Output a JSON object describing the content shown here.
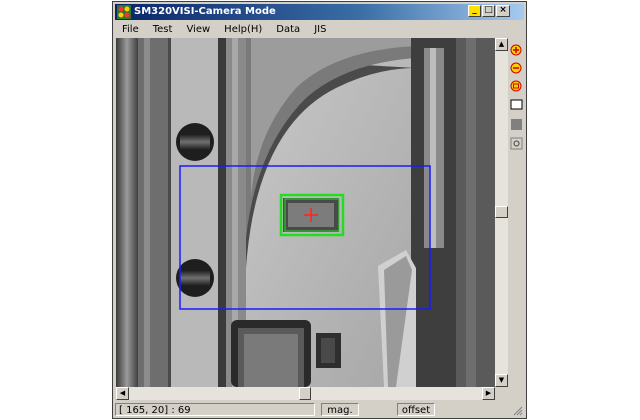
{
  "window": {
    "title": "SM320VISI-Camera Mode",
    "buttons": {
      "minimize": "_",
      "maximize": "□",
      "close": "×"
    }
  },
  "menu": {
    "items": [
      "File",
      "Test",
      "View",
      "Help(H)",
      "Data",
      "JIS"
    ]
  },
  "toolbar": {
    "icons": [
      "zoom-in-icon",
      "zoom-out-icon",
      "zoom-fit-icon",
      "rectangle-icon",
      "fill-icon",
      "settings-icon"
    ]
  },
  "status": {
    "coords": "[ 165, 20] : 69",
    "mode": "mag.",
    "offset": "offset"
  },
  "colors": {
    "roi_outer": "#1a1aff",
    "roi_inner": "#22dd22",
    "marker": "#ff2222",
    "titlebar": "#0a246a"
  }
}
